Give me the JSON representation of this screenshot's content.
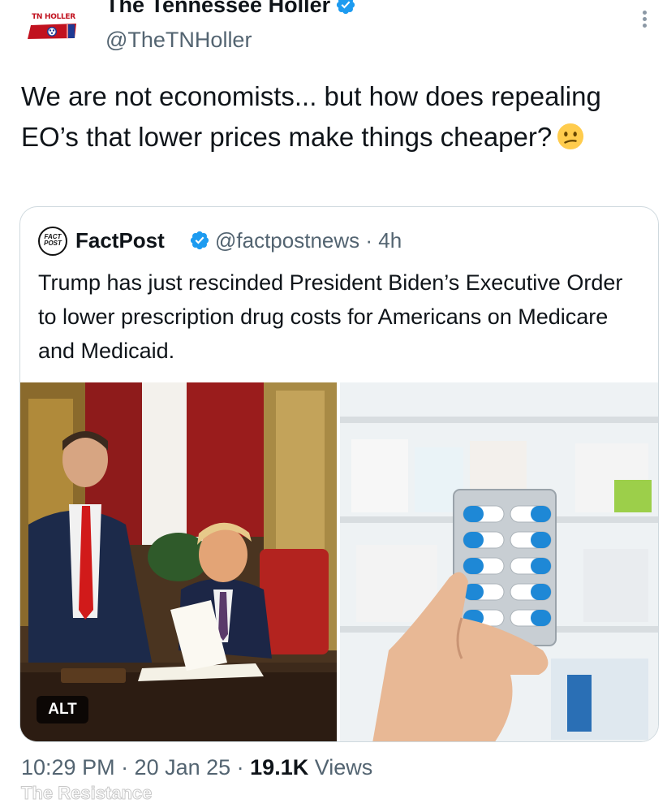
{
  "tweet": {
    "author": {
      "logo_text": "TN HOLLER",
      "display_name": "The Tennessee Holler",
      "handle": "@TheTNHoller",
      "verified": true
    },
    "text_parts": [
      "We are not economists... but how does repealing EO’s that lower prices make things cheaper?"
    ],
    "emoji": "confused-face",
    "timestamp": "10:29 PM · 20 Jan 25 · ",
    "views_count": "19.1K",
    "views_label": " Views"
  },
  "quoted": {
    "avatar_text_top": "FACT",
    "avatar_text_bottom": "POST",
    "display_name": "FactPost",
    "handle_time": "@factpostnews · 4h",
    "verified": true,
    "text": "Trump has just rescinded President Biden’s Executive Order to lower prescription drug costs for Americans on Medicare and Medicaid.",
    "alt_badge": "ALT"
  },
  "watermark": "The Resistance",
  "colors": {
    "verified_blue": "#1d9bf0",
    "secondary_text": "#536471",
    "border": "#cfd9de",
    "holler_red": "#c1121f"
  }
}
